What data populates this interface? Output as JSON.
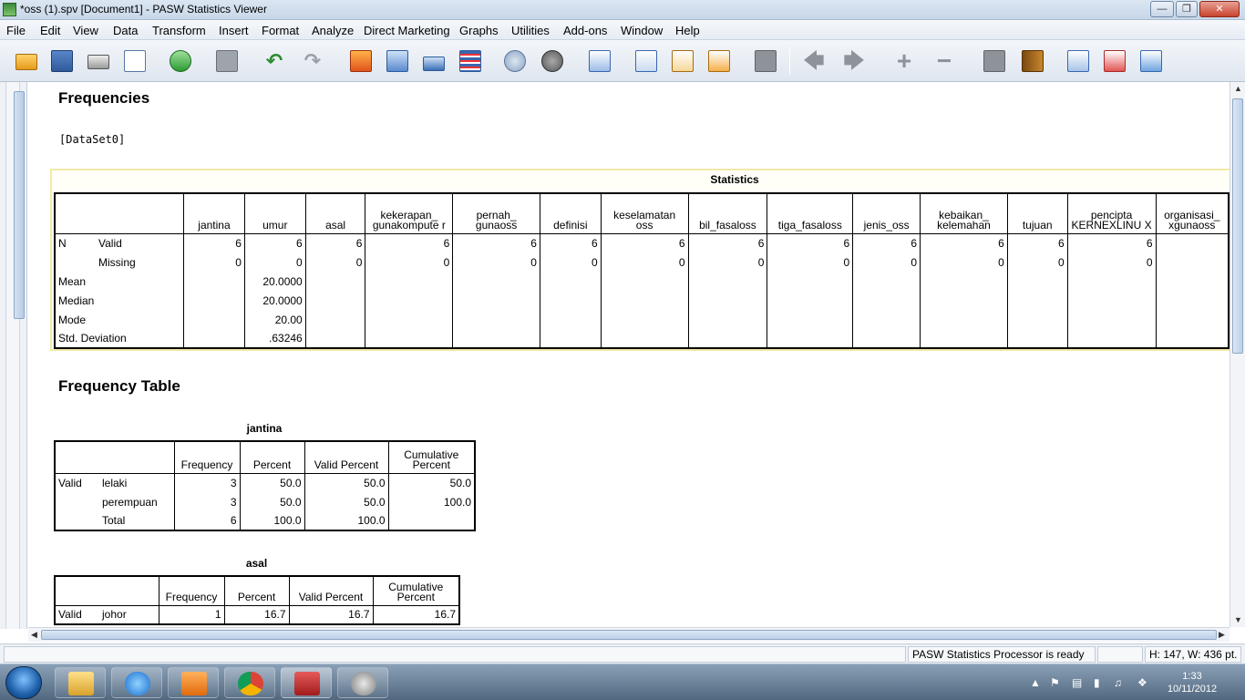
{
  "window": {
    "title": "*oss (1).spv [Document1] - PASW Statistics Viewer",
    "minimize_icon": "minimize-icon",
    "maximize_icon": "maximize-icon",
    "close_icon": "close-icon"
  },
  "menu": [
    "File",
    "Edit",
    "View",
    "Data",
    "Transform",
    "Insert",
    "Format",
    "Analyze",
    "Direct Marketing",
    "Graphs",
    "Utilities",
    "Add-ons",
    "Window",
    "Help"
  ],
  "toolbar_icons": [
    "open-icon",
    "save-icon",
    "print-icon",
    "print-preview-icon",
    "export-icon",
    "recall-dialog-icon",
    "undo-icon",
    "redo-icon",
    "goto-data-icon",
    "goto-case-icon",
    "goto-variable-icon",
    "variables-icon",
    "use-sets-icon",
    "show-all-icon",
    "designate-window-icon",
    "insert-output-icon",
    "insert-heading-icon",
    "insert-title-icon",
    "insert-text-icon",
    "select-last-output-icon",
    "promote-icon",
    "demote-icon",
    "expand-icon",
    "collapse-icon",
    "show-icon",
    "hide-icon",
    "syntax-icon",
    "book-icon",
    "pivot-icon",
    "output-icon",
    "export-output-icon"
  ],
  "output": {
    "frequencies_heading": "Frequencies",
    "dataset_label": "[DataSet0]",
    "statistics": {
      "caption": "Statistics",
      "columns": [
        "jantina",
        "umur",
        "asal",
        "kekerapan_ gunakompute r",
        "pernah_ gunaoss",
        "definisi",
        "keselamatan oss",
        "bil_fasaloss",
        "tiga_fasaloss",
        "jenis_oss",
        "kebaikan_ kelemahan",
        "tujuan",
        "pencipta KERNEXLINU X",
        "organisasi_ xgunaoss"
      ],
      "rows": [
        {
          "label1": "N",
          "label2": "Valid",
          "values": [
            "6",
            "6",
            "6",
            "6",
            "6",
            "6",
            "6",
            "6",
            "6",
            "6",
            "6",
            "6",
            "6",
            ""
          ]
        },
        {
          "label1": "",
          "label2": "Missing",
          "values": [
            "0",
            "0",
            "0",
            "0",
            "0",
            "0",
            "0",
            "0",
            "0",
            "0",
            "0",
            "0",
            "0",
            ""
          ]
        },
        {
          "label1": "Mean",
          "label2": "",
          "values": [
            "",
            "20.0000",
            "",
            "",
            "",
            "",
            "",
            "",
            "",
            "",
            "",
            "",
            "",
            ""
          ]
        },
        {
          "label1": "Median",
          "label2": "",
          "values": [
            "",
            "20.0000",
            "",
            "",
            "",
            "",
            "",
            "",
            "",
            "",
            "",
            "",
            "",
            ""
          ]
        },
        {
          "label1": "Mode",
          "label2": "",
          "values": [
            "",
            "20.00",
            "",
            "",
            "",
            "",
            "",
            "",
            "",
            "",
            "",
            "",
            "",
            ""
          ]
        },
        {
          "label1": "Std. Deviation",
          "label2": "",
          "values": [
            "",
            ".63246",
            "",
            "",
            "",
            "",
            "",
            "",
            "",
            "",
            "",
            "",
            "",
            ""
          ]
        }
      ]
    },
    "frequency_table_heading": "Frequency Table",
    "jantina_table": {
      "caption": "jantina",
      "headers": [
        "Frequency",
        "Percent",
        "Valid Percent",
        "Cumulative Percent"
      ],
      "group_label": "Valid",
      "rows": [
        {
          "label": "lelaki",
          "values": [
            "3",
            "50.0",
            "50.0",
            "50.0"
          ]
        },
        {
          "label": "perempuan",
          "values": [
            "3",
            "50.0",
            "50.0",
            "100.0"
          ]
        },
        {
          "label": "Total",
          "values": [
            "6",
            "100.0",
            "100.0",
            ""
          ]
        }
      ]
    },
    "asal_table": {
      "caption": "asal",
      "headers": [
        "Frequency",
        "Percent",
        "Valid Percent",
        "Cumulative Percent"
      ],
      "group_label": "Valid",
      "rows": [
        {
          "label": "johor",
          "values": [
            "1",
            "16.7",
            "16.7",
            "16.7"
          ]
        }
      ]
    }
  },
  "status": {
    "processor": "PASW Statistics Processor is ready",
    "dimensions": "H: 147, W: 436 pt."
  },
  "taskbar": {
    "apps": [
      "explorer-icon",
      "internet-explorer-icon",
      "media-player-icon",
      "chrome-icon",
      "pasw-statistics-icon",
      "app-icon"
    ],
    "time": "1:33",
    "date": "10/11/2012"
  },
  "colors": {
    "titlebar": "#c8d7e8",
    "taskbar": "#51687f",
    "selection_border": "#f3e9a8"
  }
}
